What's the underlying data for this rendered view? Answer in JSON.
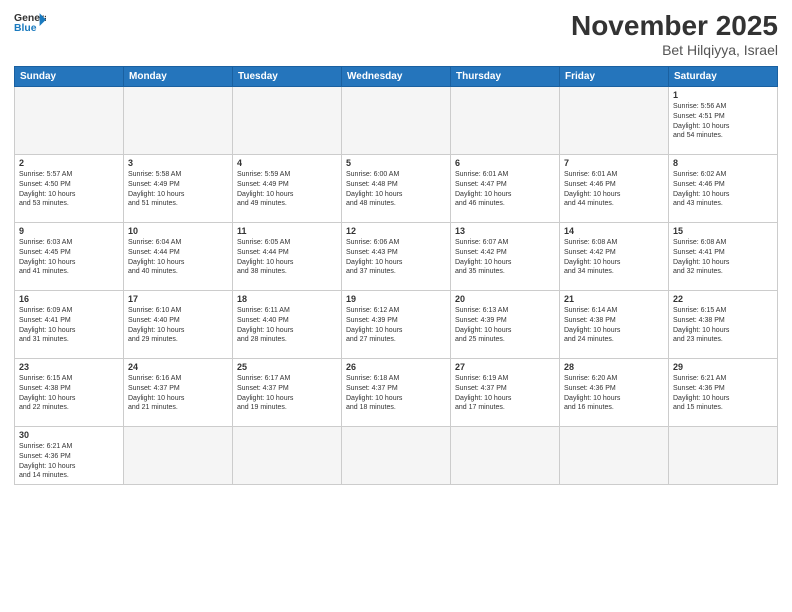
{
  "header": {
    "logo_general": "General",
    "logo_blue": "Blue",
    "month_title": "November 2025",
    "location": "Bet Hilqiyya, Israel"
  },
  "weekdays": [
    "Sunday",
    "Monday",
    "Tuesday",
    "Wednesday",
    "Thursday",
    "Friday",
    "Saturday"
  ],
  "weeks": [
    [
      {
        "num": "",
        "info": ""
      },
      {
        "num": "",
        "info": ""
      },
      {
        "num": "",
        "info": ""
      },
      {
        "num": "",
        "info": ""
      },
      {
        "num": "",
        "info": ""
      },
      {
        "num": "",
        "info": ""
      },
      {
        "num": "1",
        "info": "Sunrise: 5:56 AM\nSunset: 4:51 PM\nDaylight: 10 hours\nand 54 minutes."
      }
    ],
    [
      {
        "num": "2",
        "info": "Sunrise: 5:57 AM\nSunset: 4:50 PM\nDaylight: 10 hours\nand 53 minutes."
      },
      {
        "num": "3",
        "info": "Sunrise: 5:58 AM\nSunset: 4:49 PM\nDaylight: 10 hours\nand 51 minutes."
      },
      {
        "num": "4",
        "info": "Sunrise: 5:59 AM\nSunset: 4:49 PM\nDaylight: 10 hours\nand 49 minutes."
      },
      {
        "num": "5",
        "info": "Sunrise: 6:00 AM\nSunset: 4:48 PM\nDaylight: 10 hours\nand 48 minutes."
      },
      {
        "num": "6",
        "info": "Sunrise: 6:01 AM\nSunset: 4:47 PM\nDaylight: 10 hours\nand 46 minutes."
      },
      {
        "num": "7",
        "info": "Sunrise: 6:01 AM\nSunset: 4:46 PM\nDaylight: 10 hours\nand 44 minutes."
      },
      {
        "num": "8",
        "info": "Sunrise: 6:02 AM\nSunset: 4:46 PM\nDaylight: 10 hours\nand 43 minutes."
      }
    ],
    [
      {
        "num": "9",
        "info": "Sunrise: 6:03 AM\nSunset: 4:45 PM\nDaylight: 10 hours\nand 41 minutes."
      },
      {
        "num": "10",
        "info": "Sunrise: 6:04 AM\nSunset: 4:44 PM\nDaylight: 10 hours\nand 40 minutes."
      },
      {
        "num": "11",
        "info": "Sunrise: 6:05 AM\nSunset: 4:44 PM\nDaylight: 10 hours\nand 38 minutes."
      },
      {
        "num": "12",
        "info": "Sunrise: 6:06 AM\nSunset: 4:43 PM\nDaylight: 10 hours\nand 37 minutes."
      },
      {
        "num": "13",
        "info": "Sunrise: 6:07 AM\nSunset: 4:42 PM\nDaylight: 10 hours\nand 35 minutes."
      },
      {
        "num": "14",
        "info": "Sunrise: 6:08 AM\nSunset: 4:42 PM\nDaylight: 10 hours\nand 34 minutes."
      },
      {
        "num": "15",
        "info": "Sunrise: 6:08 AM\nSunset: 4:41 PM\nDaylight: 10 hours\nand 32 minutes."
      }
    ],
    [
      {
        "num": "16",
        "info": "Sunrise: 6:09 AM\nSunset: 4:41 PM\nDaylight: 10 hours\nand 31 minutes."
      },
      {
        "num": "17",
        "info": "Sunrise: 6:10 AM\nSunset: 4:40 PM\nDaylight: 10 hours\nand 29 minutes."
      },
      {
        "num": "18",
        "info": "Sunrise: 6:11 AM\nSunset: 4:40 PM\nDaylight: 10 hours\nand 28 minutes."
      },
      {
        "num": "19",
        "info": "Sunrise: 6:12 AM\nSunset: 4:39 PM\nDaylight: 10 hours\nand 27 minutes."
      },
      {
        "num": "20",
        "info": "Sunrise: 6:13 AM\nSunset: 4:39 PM\nDaylight: 10 hours\nand 25 minutes."
      },
      {
        "num": "21",
        "info": "Sunrise: 6:14 AM\nSunset: 4:38 PM\nDaylight: 10 hours\nand 24 minutes."
      },
      {
        "num": "22",
        "info": "Sunrise: 6:15 AM\nSunset: 4:38 PM\nDaylight: 10 hours\nand 23 minutes."
      }
    ],
    [
      {
        "num": "23",
        "info": "Sunrise: 6:15 AM\nSunset: 4:38 PM\nDaylight: 10 hours\nand 22 minutes."
      },
      {
        "num": "24",
        "info": "Sunrise: 6:16 AM\nSunset: 4:37 PM\nDaylight: 10 hours\nand 21 minutes."
      },
      {
        "num": "25",
        "info": "Sunrise: 6:17 AM\nSunset: 4:37 PM\nDaylight: 10 hours\nand 19 minutes."
      },
      {
        "num": "26",
        "info": "Sunrise: 6:18 AM\nSunset: 4:37 PM\nDaylight: 10 hours\nand 18 minutes."
      },
      {
        "num": "27",
        "info": "Sunrise: 6:19 AM\nSunset: 4:37 PM\nDaylight: 10 hours\nand 17 minutes."
      },
      {
        "num": "28",
        "info": "Sunrise: 6:20 AM\nSunset: 4:36 PM\nDaylight: 10 hours\nand 16 minutes."
      },
      {
        "num": "29",
        "info": "Sunrise: 6:21 AM\nSunset: 4:36 PM\nDaylight: 10 hours\nand 15 minutes."
      }
    ],
    [
      {
        "num": "30",
        "info": "Sunrise: 6:21 AM\nSunset: 4:36 PM\nDaylight: 10 hours\nand 14 minutes."
      },
      {
        "num": "",
        "info": ""
      },
      {
        "num": "",
        "info": ""
      },
      {
        "num": "",
        "info": ""
      },
      {
        "num": "",
        "info": ""
      },
      {
        "num": "",
        "info": ""
      },
      {
        "num": "",
        "info": ""
      }
    ]
  ]
}
